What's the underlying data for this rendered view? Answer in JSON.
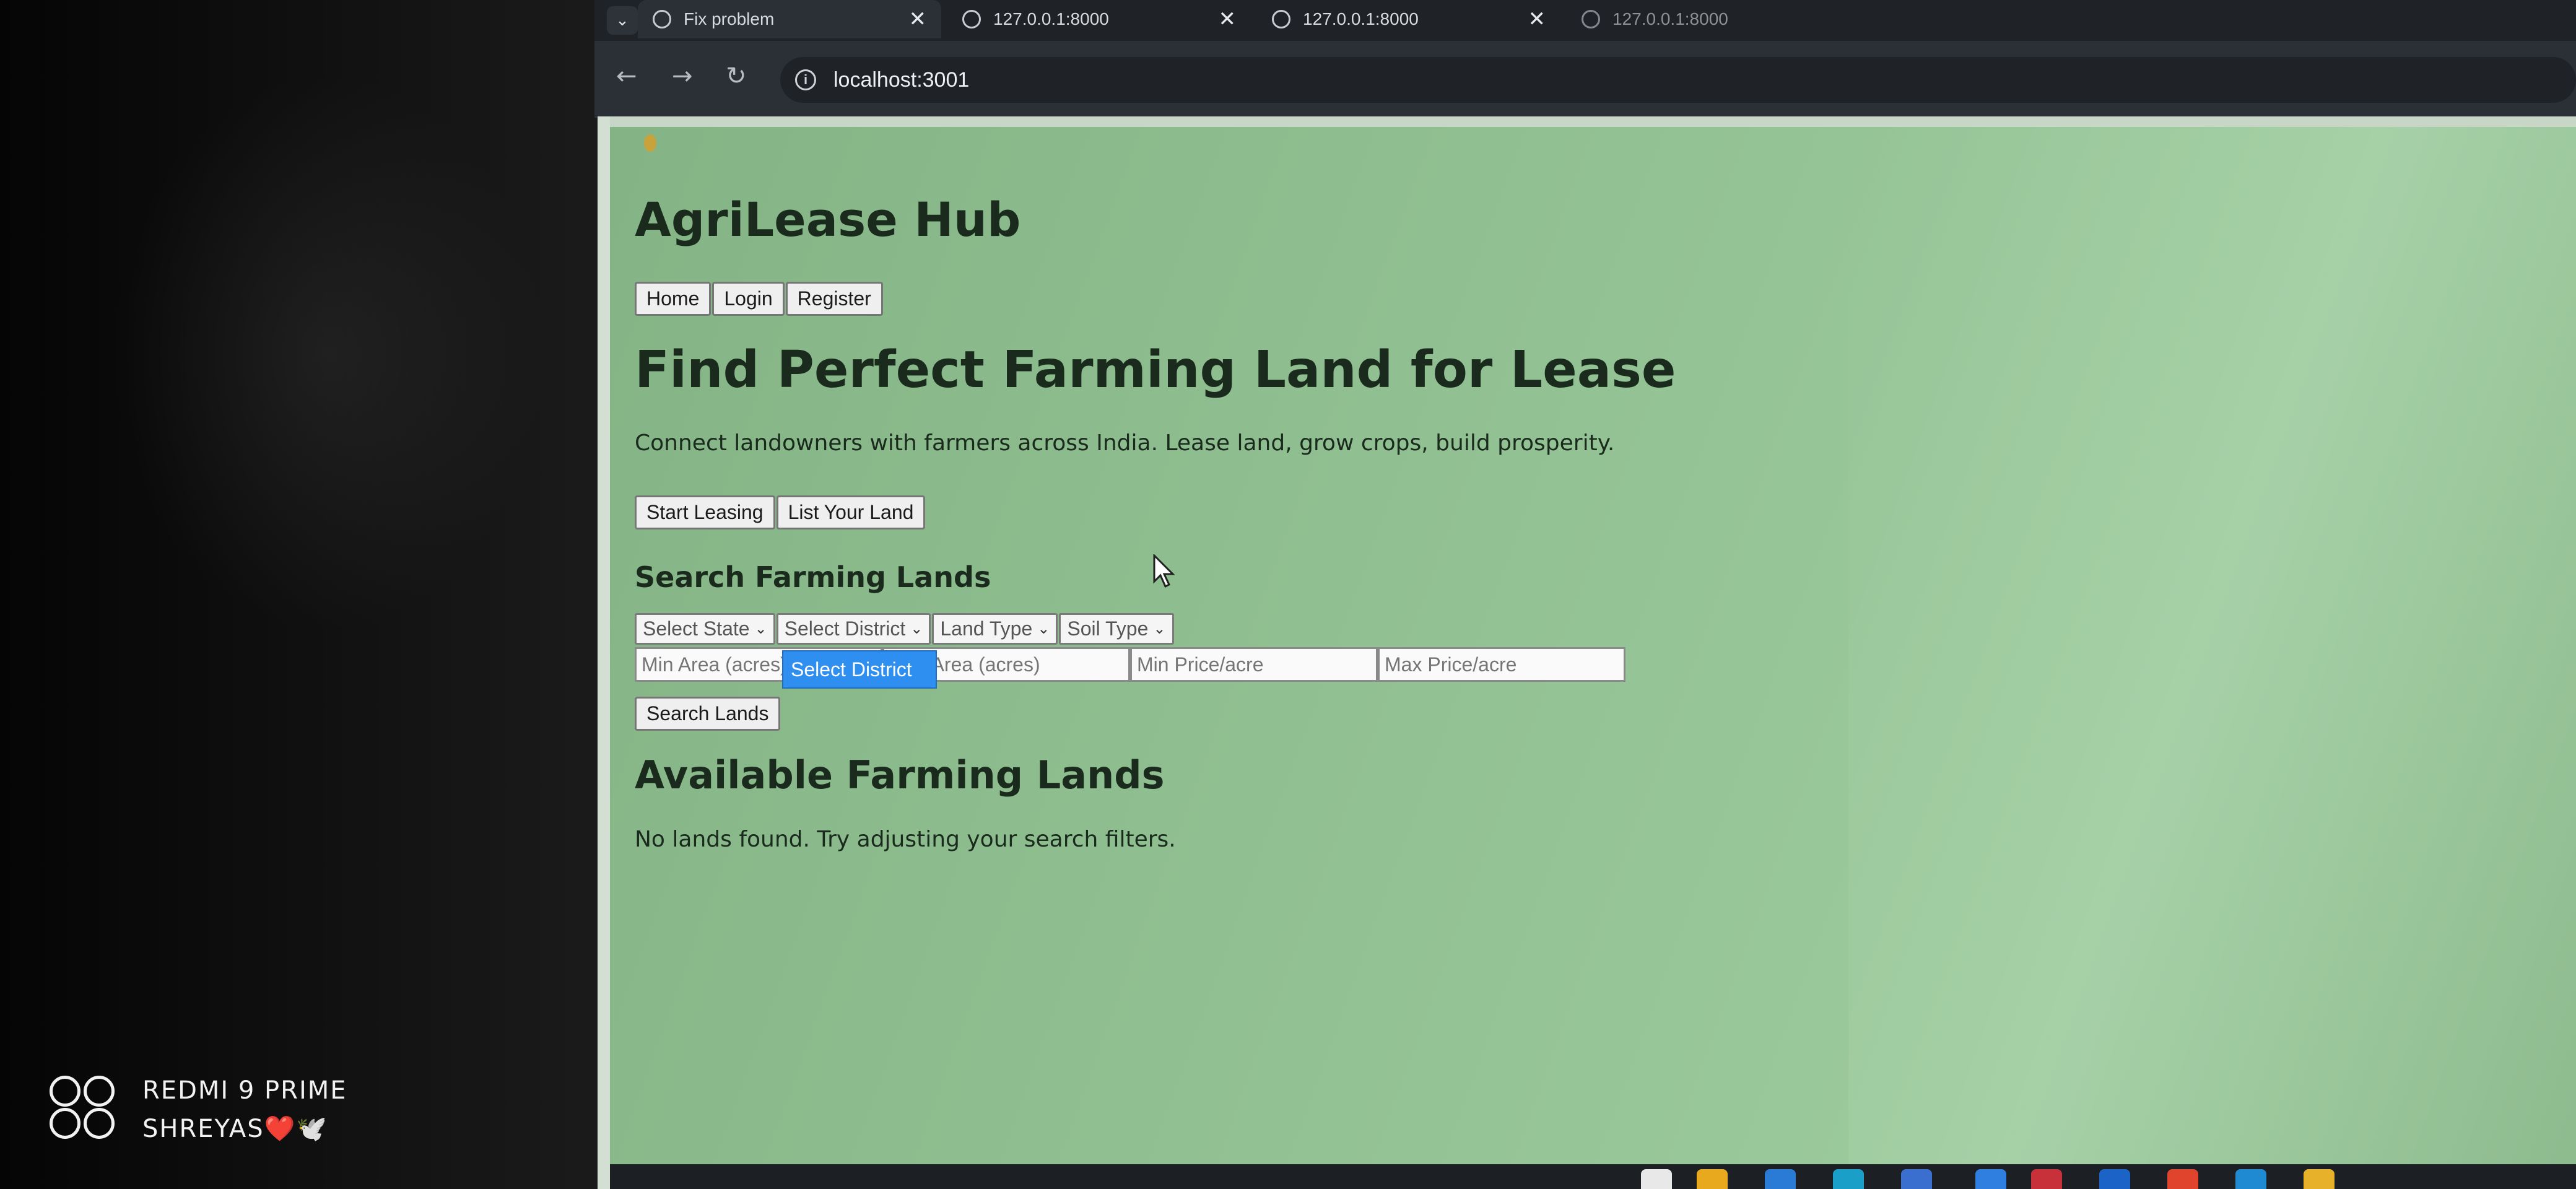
{
  "browser": {
    "tabs": [
      {
        "title": "Fix problem",
        "active": true
      },
      {
        "title": "127.0.0.1:8000",
        "active": false
      },
      {
        "title": "127.0.0.1:8000",
        "active": false
      },
      {
        "title": "127.0.0.1:8000",
        "active": false
      }
    ],
    "url": "localhost:3001",
    "close_glyph": "✕",
    "menu_glyph": "⌄"
  },
  "site": {
    "title": "AgriLease Hub",
    "nav": [
      "Home",
      "Login",
      "Register"
    ]
  },
  "hero": {
    "title": "Find Perfect Farming Land for Lease",
    "subtitle": "Connect landowners with farmers across India. Lease land, grow crops, build prosperity.",
    "buttons": [
      "Start Leasing",
      "List Your Land"
    ]
  },
  "search": {
    "title": "Search Farming Lands",
    "selects": [
      "Select State",
      "Select District",
      "Land Type",
      "Soil Type"
    ],
    "inputs": [
      "Min Area (acres)",
      "Max Area (acres)",
      "Min Price/acre",
      "Max Price/acre"
    ],
    "dropdown_highlight": "Select District",
    "submit_label": "Search Lands"
  },
  "results": {
    "title": "Available Farming Lands",
    "empty_message": "No lands found. Try adjusting your search filters."
  },
  "watermark": {
    "line1": "REDMI 9 PRIME",
    "line2": "SHREYAS❤️🕊️"
  }
}
